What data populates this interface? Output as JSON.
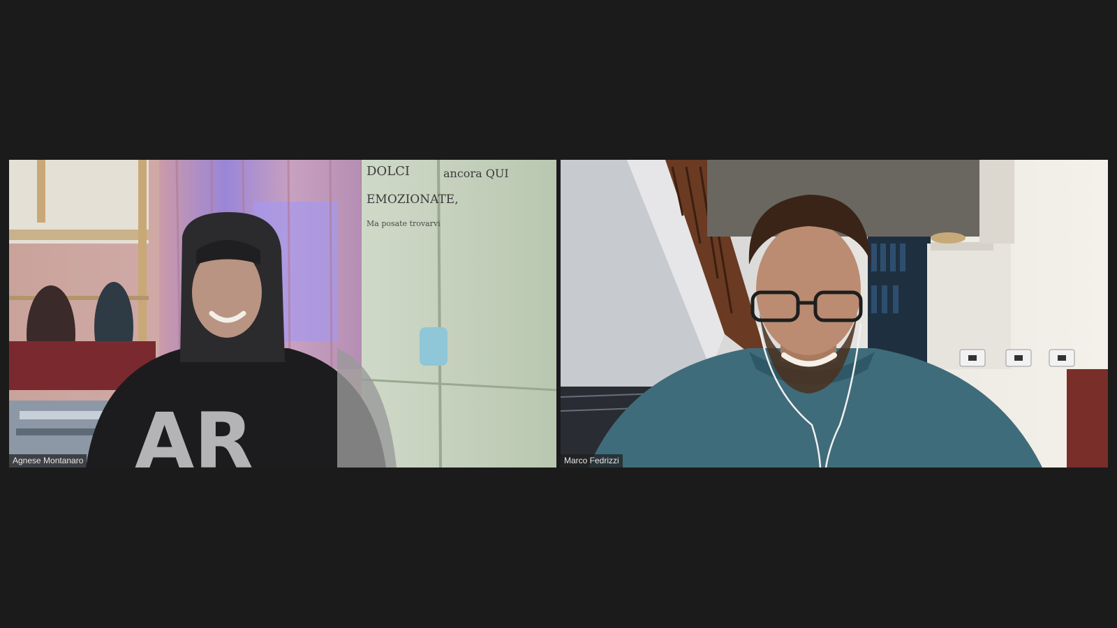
{
  "meeting": {
    "participants": [
      {
        "name": "Agnese Montanaro"
      },
      {
        "name": "Marco Fedrizzi"
      }
    ]
  },
  "scene_text": {
    "door_lines": [
      "DOLCI",
      "EMOZIONATE,",
      "Ma posate trovarvi",
      "ancora QUI"
    ]
  },
  "colors": {
    "background": "#1b1b1b",
    "name_tag_bg": "rgba(30,30,30,0.72)",
    "name_tag_text": "#e8e8e8"
  }
}
